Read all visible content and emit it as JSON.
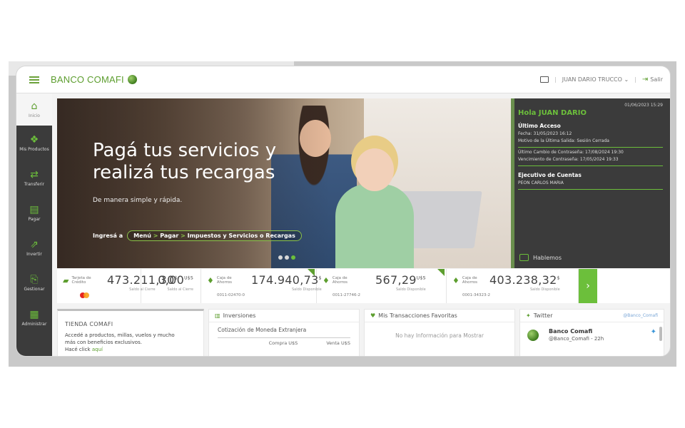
{
  "header": {
    "brand": "BANCO COMAFI",
    "user_name": "JUAN DARIO TRUCCO ⌄",
    "logout_label": "Salir"
  },
  "sidebar": {
    "items": [
      {
        "label": "Inicio",
        "icon": "home-icon"
      },
      {
        "label": "Mis Productos",
        "icon": "products-icon"
      },
      {
        "label": "Transferir",
        "icon": "transfer-icon"
      },
      {
        "label": "Pagar",
        "icon": "pay-icon"
      },
      {
        "label": "Invertir",
        "icon": "invest-icon"
      },
      {
        "label": "Gestionar",
        "icon": "manage-icon"
      },
      {
        "label": "Administrar",
        "icon": "admin-icon"
      }
    ]
  },
  "hero": {
    "title_line1": "Pagá tus servicios y",
    "title_line2": "realizá tus recargas",
    "subtitle": "De manera simple y rápida.",
    "cta_prefix": "Ingresá a",
    "cta_part1": "Menú",
    "cta_sep1": " > ",
    "cta_part2": "Pagar",
    "cta_sep2": " > ",
    "cta_part3": "Impuestos y Servicios o Recargas"
  },
  "info": {
    "date": "01/06/2023 15:29",
    "greeting": "Hola JUAN DARIO",
    "last_access_label": "Último Acceso",
    "last_access_date": "Fecha: 31/05/2023 16:12",
    "last_exit_reason": "Motivo de la Última Salida: Sesión Cerrada",
    "pwd_change": "Último Cambio de Contraseña: 17/08/2024 19:30",
    "pwd_expiry": "Vencimiento de Contraseña: 17/05/2024 19:33",
    "executive_label": "Ejecutivo de Cuentas",
    "executive_name": "PEON CARLOS MARIA",
    "chat_label": "Hablemos"
  },
  "accounts": [
    {
      "label": "Tarjeta de Crédito",
      "value": "473.211,30",
      "currency": "$",
      "caption": "Saldo al Cierre",
      "number": ""
    },
    {
      "label": "",
      "value": "0,00",
      "currency": "U$S",
      "caption": "Saldo al Cierre",
      "number": ""
    },
    {
      "label": "Caja de Ahorros",
      "value": "174.940,73",
      "currency": "$",
      "caption": "Saldo Disponible",
      "number": "0011-02470-0"
    },
    {
      "label": "Caja de Ahorros",
      "value": "567,29",
      "currency": "U$S",
      "caption": "Saldo Disponible",
      "number": "0011-27746-2"
    },
    {
      "label": "Caja de Ahorros",
      "value": "403.238,32",
      "currency": "$",
      "caption": "Saldo Disponible",
      "number": "0001-34323-2"
    }
  ],
  "panels": {
    "tienda": {
      "title": "TIENDA COMAFI",
      "desc1": "Accedé a productos, millas, vuelos y mucho",
      "desc2": "más con beneficios exclusivos.",
      "link_prefix": "Hacé click",
      "link": "aquí"
    },
    "inversiones": {
      "title": "Inversiones",
      "subtitle": "Cotización de Moneda Extranjera",
      "col_buy": "Compra U$S",
      "col_sell": "Venta U$S"
    },
    "favoritas": {
      "title": "Mis Transacciones Favoritas",
      "empty": "No hay Información para Mostrar"
    },
    "twitter": {
      "title": "Twitter",
      "handle_link": "@Banco_Comafi",
      "name": "Banco Comafi",
      "handle": "@Banco_Comafi - 22h"
    }
  },
  "colors": {
    "brand_green": "#5d9e2f",
    "accent_green": "#6cbf3b",
    "sidebar": "#3b3b3b"
  }
}
